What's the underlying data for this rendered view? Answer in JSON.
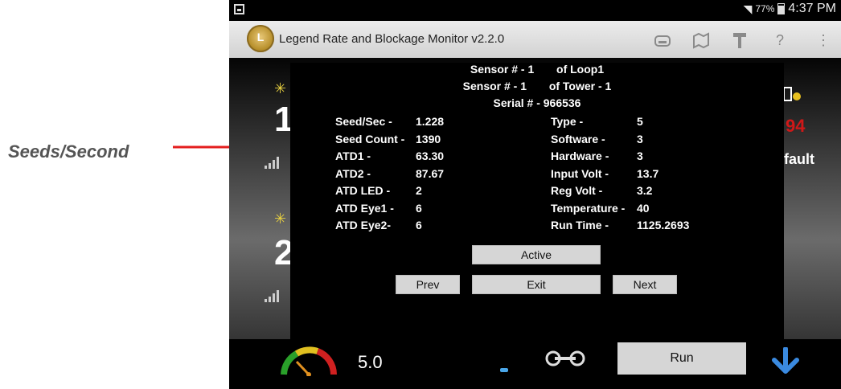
{
  "annotation": {
    "label": "Seeds/Second",
    "arrow_color": "#e41e1e"
  },
  "status_bar": {
    "battery": "77%",
    "time": "4:37 PM"
  },
  "app": {
    "title": "Legend Rate and Blockage Monitor v2.2.0",
    "logo_letter": "L"
  },
  "action_icons": [
    "device-icon",
    "map-icon",
    "wrench-icon",
    "help-icon",
    "overflow-menu-icon"
  ],
  "background": {
    "row1_number": "1",
    "row2_number": "2",
    "right_red": "94",
    "right_text": "fault"
  },
  "dialog": {
    "line1": {
      "left": "Sensor # - 1",
      "right": "of Loop1"
    },
    "line2": {
      "left": "Sensor # - 1",
      "right": "of Tower - 1"
    },
    "serial": "Serial # - 966536",
    "left_fields": [
      {
        "label": "Seed/Sec -",
        "value": "1.228"
      },
      {
        "label": "Seed Count -",
        "value": "1390"
      },
      {
        "label": "ATD1 -",
        "value": "63.30"
      },
      {
        "label": "ATD2 -",
        "value": "87.67"
      },
      {
        "label": "ATD LED -",
        "value": "2"
      },
      {
        "label": "ATD Eye1 -",
        "value": "6"
      },
      {
        "label": "ATD Eye2-",
        "value": "6"
      }
    ],
    "right_fields": [
      {
        "label": "Type -",
        "value": "5"
      },
      {
        "label": "Software -",
        "value": "3"
      },
      {
        "label": "Hardware -",
        "value": "3"
      },
      {
        "label": "Input Volt -",
        "value": "13.7"
      },
      {
        "label": "Reg Volt -",
        "value": "3.2"
      },
      {
        "label": "Temperature -",
        "value": "40"
      },
      {
        "label": "Run Time -",
        "value": "1125.2693"
      }
    ],
    "active_label": "Active",
    "prev_label": "Prev",
    "exit_label": "Exit",
    "next_label": "Next"
  },
  "bottom_bar": {
    "speed": "5.0",
    "run_label": "Run"
  }
}
